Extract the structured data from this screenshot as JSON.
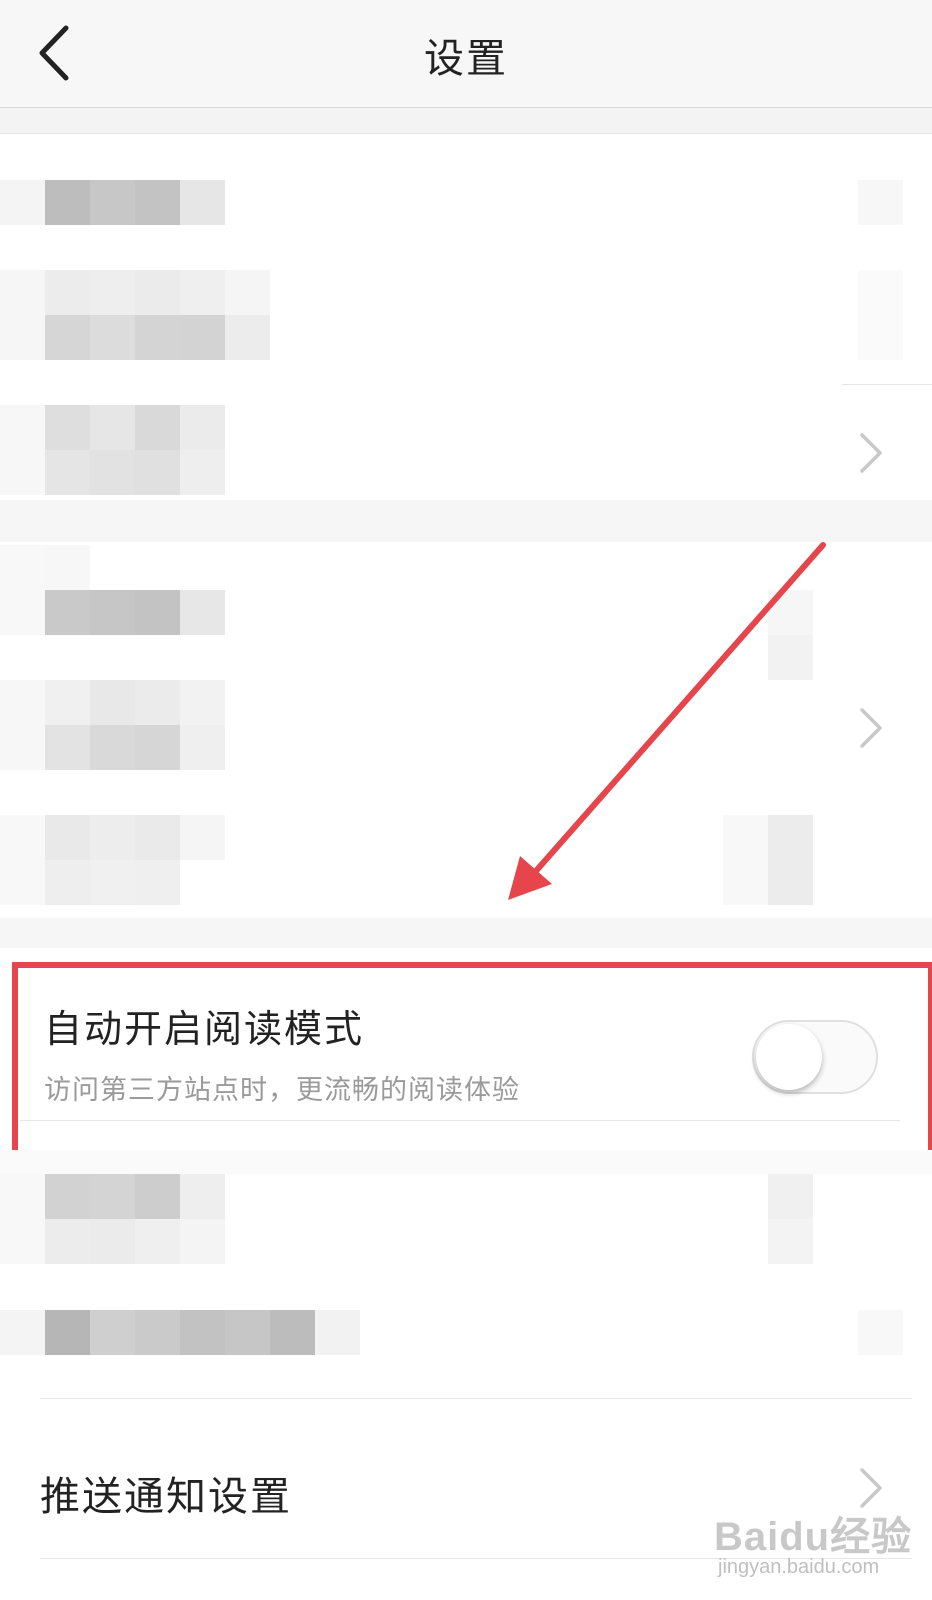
{
  "header": {
    "title": "设置",
    "back_icon": "chevron-left-icon"
  },
  "reading_mode": {
    "title": "自动开启阅读模式",
    "subtitle": "访问第三方站点时，更流畅的阅读体验",
    "toggle_on": false
  },
  "push_settings": {
    "label": "推送通知设置",
    "chevron_icon": "chevron-right-icon"
  },
  "watermark": {
    "brand": "Baidu经验",
    "url": "jingyan.baidu.com"
  },
  "colors": {
    "highlight": "#e6464b",
    "arrow": "#e6464b",
    "chevron": "#c8c8c8"
  },
  "obscured_rows": 8
}
